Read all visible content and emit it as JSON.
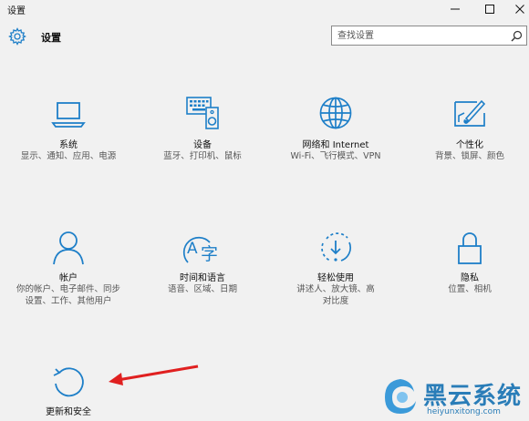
{
  "window": {
    "title": "设置"
  },
  "header": {
    "title": "设置"
  },
  "search": {
    "placeholder": "查找设置"
  },
  "tiles": [
    {
      "name": "系统",
      "desc": "显示、通知、应用、电源"
    },
    {
      "name": "设备",
      "desc": "蓝牙、打印机、鼠标"
    },
    {
      "name": "网络和 Internet",
      "desc": "Wi-Fi、飞行模式、VPN"
    },
    {
      "name": "个性化",
      "desc": "背景、锁屏、颜色"
    },
    {
      "name": "帐户",
      "desc": "你的帐户、电子邮件、同步设置、工作、其他用户"
    },
    {
      "name": "时间和语言",
      "desc": "语音、区域、日期"
    },
    {
      "name": "轻松使用",
      "desc": "讲述人、放大镜、高对比度"
    },
    {
      "name": "隐私",
      "desc": "位置、相机"
    },
    {
      "name": "更新和安全",
      "desc": ""
    }
  ],
  "watermark": {
    "brand": "黑云系统",
    "url": "heiyunxitong.com"
  },
  "colors": {
    "accent": "#1e7fc8",
    "arrow": "#e02020",
    "background": "#f1f1f1"
  },
  "icons": [
    "gear-icon",
    "search-icon",
    "laptop-icon",
    "keyboard-speaker-icon",
    "globe-icon",
    "paint-icon",
    "person-icon",
    "language-clock-icon",
    "accessibility-icon",
    "lock-icon",
    "refresh-icon",
    "cloud-logo-icon"
  ]
}
